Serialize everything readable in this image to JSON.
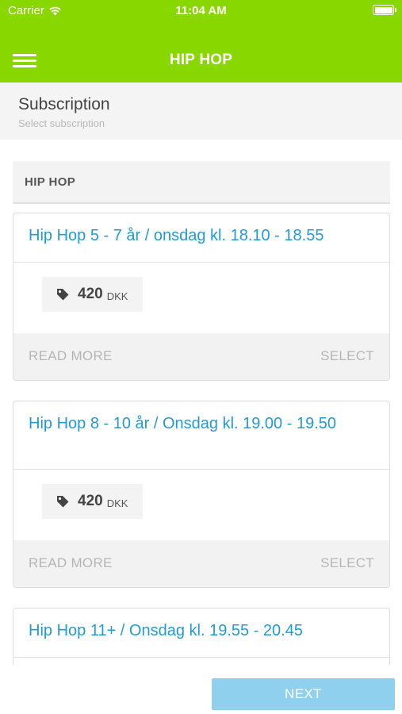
{
  "status_bar": {
    "carrier": "Carrier",
    "time": "11:04 AM"
  },
  "nav": {
    "title": "HIP HOP",
    "menu_icon": "hamburger-menu-icon"
  },
  "subheader": {
    "title": "Subscription",
    "hint": "Select subscription"
  },
  "section": {
    "label": "HIP HOP"
  },
  "cards": [
    {
      "title": "Hip Hop 5 - 7 år / onsdag kl. 18.10 - 18.55",
      "price": "420",
      "currency": "DKK",
      "read_more": "READ MORE",
      "select": "SELECT"
    },
    {
      "title": "Hip Hop 8 - 10 år / Onsdag kl. 19.00 - 19.50",
      "price": "420",
      "currency": "DKK",
      "read_more": "READ MORE",
      "select": "SELECT"
    },
    {
      "title": "Hip Hop 11+ / Onsdag kl. 19.55 - 20.45"
    }
  ],
  "footer": {
    "next_label": "NEXT"
  },
  "colors": {
    "brand_green": "#88d800",
    "link_blue": "#1f9bd6",
    "next_button": "#8fd0ee"
  }
}
